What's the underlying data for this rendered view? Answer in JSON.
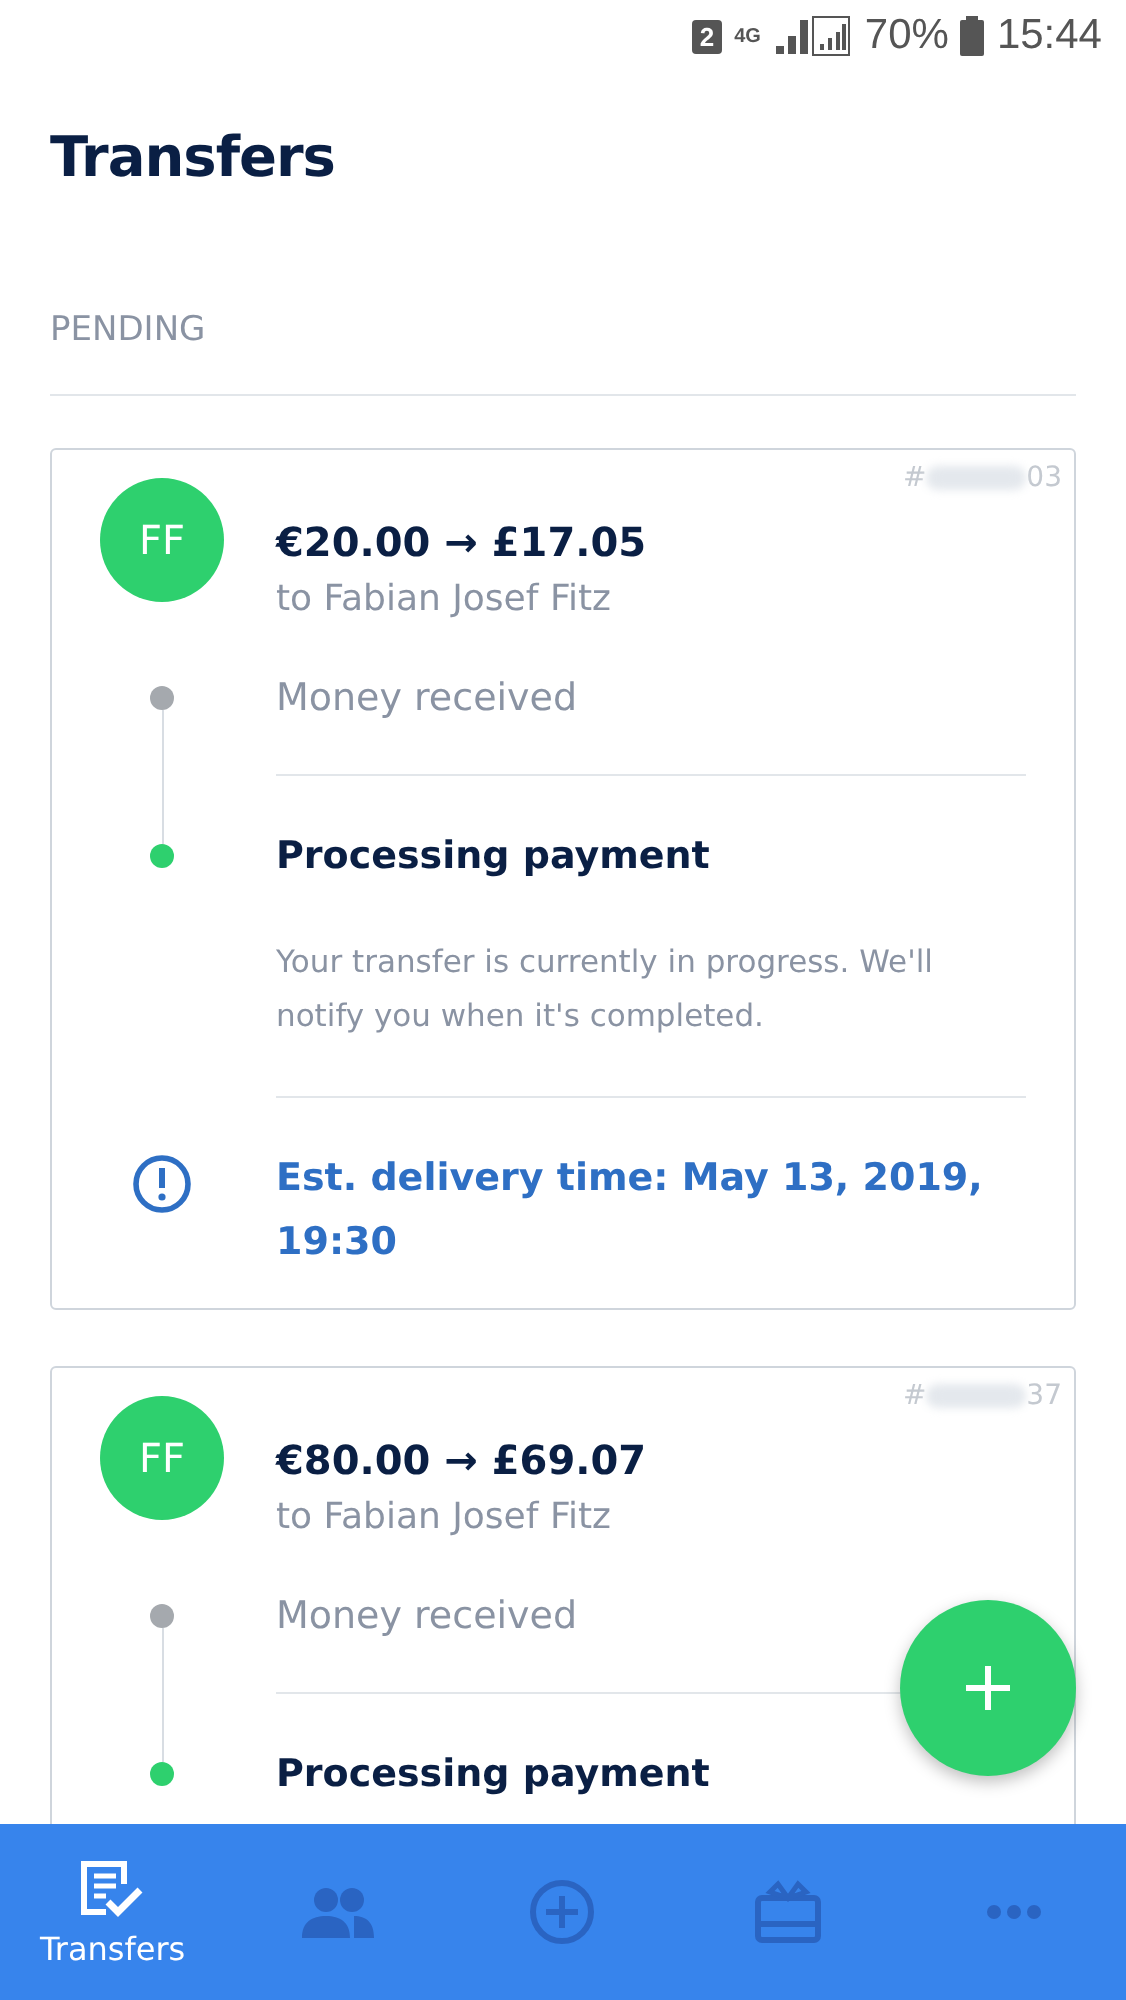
{
  "status_bar": {
    "sim": "2",
    "network": "4G",
    "battery": "70%",
    "time": "15:44"
  },
  "title": "Transfers",
  "section": "PENDING",
  "transfers": [
    {
      "ref_prefix": "#",
      "ref_suffix": "03",
      "initials": "FF",
      "amount": "€20.00 → £17.05",
      "recipient": "to Fabian Josef Fitz",
      "steps": [
        {
          "label": "Money received",
          "current": false
        },
        {
          "label": "Processing payment",
          "current": true,
          "description": "Your transfer is currently in progress. We'll notify you when it's completed."
        }
      ],
      "delivery": "Est. delivery time: May 13, 2019, 19:30"
    },
    {
      "ref_prefix": "#",
      "ref_suffix": "37",
      "initials": "FF",
      "amount": "€80.00 → £69.07",
      "recipient": "to Fabian Josef Fitz",
      "steps": [
        {
          "label": "Money received",
          "current": false
        },
        {
          "label": "Processing payment",
          "current": true
        }
      ]
    }
  ],
  "nav": [
    {
      "kind": "transfers",
      "label": "Transfers",
      "selected": true
    },
    {
      "kind": "recipients",
      "selected": false
    },
    {
      "kind": "send",
      "selected": false
    },
    {
      "kind": "gift",
      "selected": false
    },
    {
      "kind": "more",
      "selected": false
    }
  ]
}
